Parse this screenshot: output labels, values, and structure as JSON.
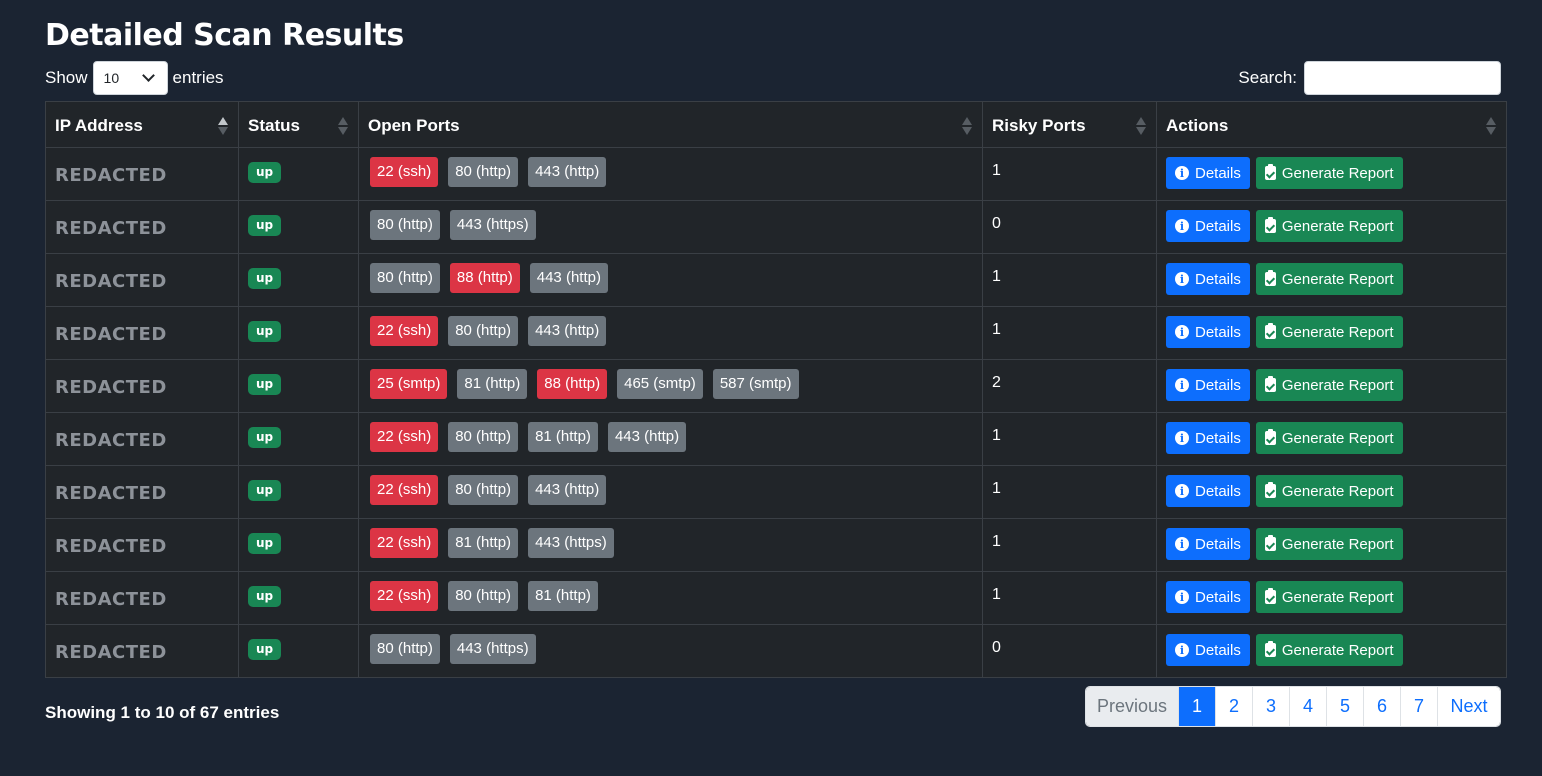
{
  "title": "Detailed Scan Results",
  "length_control": {
    "show_label": "Show",
    "selected": "10",
    "entries_label": "entries"
  },
  "search": {
    "label": "Search:",
    "value": ""
  },
  "columns": [
    "IP Address",
    "Status",
    "Open Ports",
    "Risky Ports",
    "Actions"
  ],
  "actions": {
    "details_label": "Details",
    "report_label": "Generate Report"
  },
  "rows": [
    {
      "ip": "REDACTED",
      "status": "up",
      "ports": [
        {
          "label": "22 (ssh)",
          "risky": true
        },
        {
          "label": "80 (http)",
          "risky": false
        },
        {
          "label": "443 (http)",
          "risky": false
        }
      ],
      "risky_count": "1"
    },
    {
      "ip": "REDACTED",
      "status": "up",
      "ports": [
        {
          "label": "80 (http)",
          "risky": false
        },
        {
          "label": "443 (https)",
          "risky": false
        }
      ],
      "risky_count": "0"
    },
    {
      "ip": "REDACTED",
      "status": "up",
      "ports": [
        {
          "label": "80 (http)",
          "risky": false
        },
        {
          "label": "88 (http)",
          "risky": true
        },
        {
          "label": "443 (http)",
          "risky": false
        }
      ],
      "risky_count": "1"
    },
    {
      "ip": "REDACTED",
      "status": "up",
      "ports": [
        {
          "label": "22 (ssh)",
          "risky": true
        },
        {
          "label": "80 (http)",
          "risky": false
        },
        {
          "label": "443 (http)",
          "risky": false
        }
      ],
      "risky_count": "1"
    },
    {
      "ip": "REDACTED",
      "status": "up",
      "ports": [
        {
          "label": "25 (smtp)",
          "risky": true
        },
        {
          "label": "81 (http)",
          "risky": false
        },
        {
          "label": "88 (http)",
          "risky": true
        },
        {
          "label": "465 (smtp)",
          "risky": false
        },
        {
          "label": "587 (smtp)",
          "risky": false
        }
      ],
      "risky_count": "2"
    },
    {
      "ip": "REDACTED",
      "status": "up",
      "ports": [
        {
          "label": "22 (ssh)",
          "risky": true
        },
        {
          "label": "80 (http)",
          "risky": false
        },
        {
          "label": "81 (http)",
          "risky": false
        },
        {
          "label": "443 (http)",
          "risky": false
        }
      ],
      "risky_count": "1"
    },
    {
      "ip": "REDACTED",
      "status": "up",
      "ports": [
        {
          "label": "22 (ssh)",
          "risky": true
        },
        {
          "label": "80 (http)",
          "risky": false
        },
        {
          "label": "443 (http)",
          "risky": false
        }
      ],
      "risky_count": "1"
    },
    {
      "ip": "REDACTED",
      "status": "up",
      "ports": [
        {
          "label": "22 (ssh)",
          "risky": true
        },
        {
          "label": "81 (http)",
          "risky": false
        },
        {
          "label": "443 (https)",
          "risky": false
        }
      ],
      "risky_count": "1"
    },
    {
      "ip": "REDACTED",
      "status": "up",
      "ports": [
        {
          "label": "22 (ssh)",
          "risky": true
        },
        {
          "label": "80 (http)",
          "risky": false
        },
        {
          "label": "81 (http)",
          "risky": false
        }
      ],
      "risky_count": "1"
    },
    {
      "ip": "REDACTED",
      "status": "up",
      "ports": [
        {
          "label": "80 (http)",
          "risky": false
        },
        {
          "label": "443 (https)",
          "risky": false
        }
      ],
      "risky_count": "0"
    }
  ],
  "footer": {
    "info": "Showing 1 to 10 of 67 entries",
    "pagination": {
      "previous": "Previous",
      "pages": [
        "1",
        "2",
        "3",
        "4",
        "5",
        "6",
        "7"
      ],
      "active": "1",
      "next": "Next"
    }
  },
  "colors": {
    "background": "#1b2432",
    "table": "#212529",
    "risky_port": "#dc3545",
    "port": "#6c757d",
    "status_up": "#198754",
    "details_button": "#0d6efd",
    "report_button": "#198754"
  },
  "icons": {
    "details": "info-circle-icon",
    "report": "clipboard-check-icon",
    "sort": "sort-arrows-icon",
    "select": "chevron-down-icon"
  }
}
